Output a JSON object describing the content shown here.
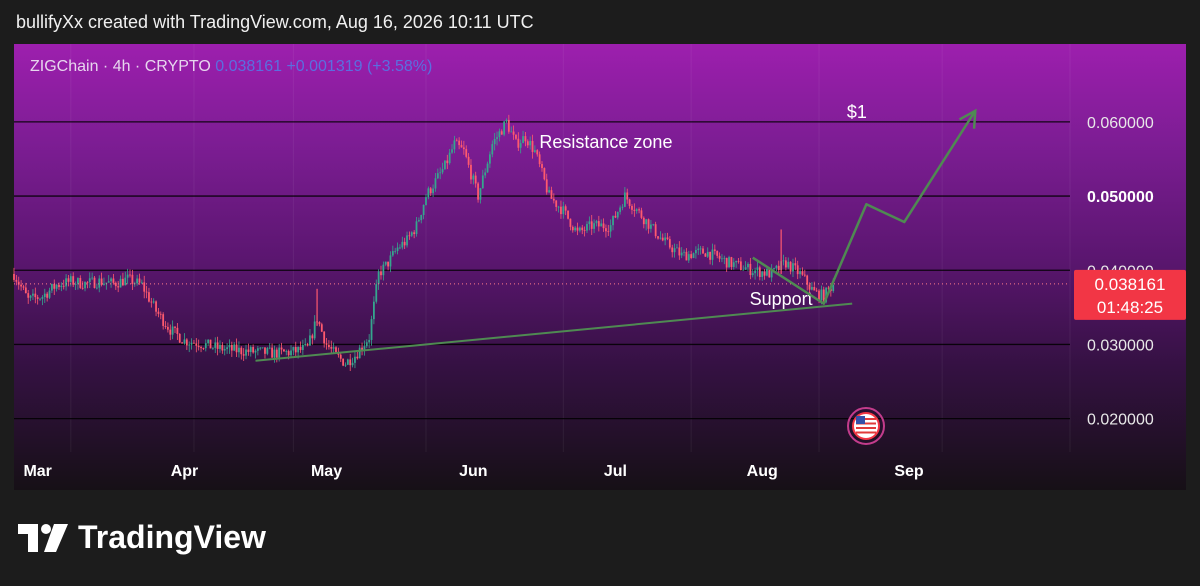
{
  "header": {
    "text": "bullifyXx created with TradingView.com, Aug 16, 2026 10:11 UTC"
  },
  "symbol": {
    "name": "ZIGChain",
    "interval": "4h",
    "type": "CRYPTO",
    "price": "0.038161",
    "change": "+0.001319 (+3.58%)"
  },
  "price_tag": {
    "price": "0.038161",
    "countdown": "01:48:25",
    "color": "#f23645"
  },
  "brand": {
    "name": "TradingView"
  },
  "colors": {
    "line": "#4f8a52",
    "up": "#35a68e",
    "down": "#ff5a6e",
    "gridline": "#000000"
  },
  "chart_data": {
    "type": "candlestick",
    "interval": "4h",
    "x_tick_labels": [
      "Mar",
      "Apr",
      "May",
      "Jun",
      "Jul",
      "Aug",
      "Sep"
    ],
    "y_tick_labels": [
      "0.060000",
      "0.050000",
      "0.040000",
      "0.030000",
      "0.020000"
    ],
    "y_ticks": [
      0.06,
      0.05,
      0.04,
      0.03,
      0.02
    ],
    "bold_y_tick": 0.05,
    "ylim": [
      0.0155,
      0.0705
    ],
    "xlim": [
      "2026-02-24",
      "2026-10-05"
    ],
    "current_price": 0.038161,
    "price_series": {
      "dates": [
        "2026-02-24",
        "2026-02-27",
        "2026-03-02",
        "2026-03-05",
        "2026-03-08",
        "2026-03-11",
        "2026-03-14",
        "2026-03-17",
        "2026-03-20",
        "2026-03-23",
        "2026-03-26",
        "2026-03-29",
        "2026-04-01",
        "2026-04-04",
        "2026-04-08",
        "2026-04-12",
        "2026-04-16",
        "2026-04-20",
        "2026-04-24",
        "2026-04-27",
        "2026-04-29",
        "2026-05-01",
        "2026-05-03",
        "2026-05-05",
        "2026-05-07",
        "2026-05-10",
        "2026-05-12",
        "2026-05-14",
        "2026-05-16",
        "2026-05-18",
        "2026-05-20",
        "2026-05-22",
        "2026-05-24",
        "2026-05-26",
        "2026-05-28",
        "2026-05-30",
        "2026-06-02",
        "2026-06-05",
        "2026-06-08",
        "2026-06-10",
        "2026-06-12",
        "2026-06-14",
        "2026-06-17",
        "2026-06-20",
        "2026-06-23",
        "2026-06-26",
        "2026-06-30",
        "2026-07-03",
        "2026-07-07",
        "2026-07-11",
        "2026-07-15",
        "2026-07-20",
        "2026-07-25",
        "2026-07-30",
        "2026-08-03",
        "2026-08-06",
        "2026-08-09",
        "2026-08-12",
        "2026-08-14",
        "2026-08-16"
      ],
      "close": [
        0.0395,
        0.036,
        0.0365,
        0.038,
        0.0385,
        0.0382,
        0.0385,
        0.0382,
        0.0388,
        0.038,
        0.0345,
        0.032,
        0.0305,
        0.0302,
        0.0295,
        0.0292,
        0.029,
        0.0288,
        0.029,
        0.0295,
        0.0335,
        0.03,
        0.0285,
        0.0275,
        0.0285,
        0.031,
        0.0395,
        0.041,
        0.043,
        0.044,
        0.046,
        0.05,
        0.052,
        0.054,
        0.057,
        0.056,
        0.05,
        0.057,
        0.06,
        0.057,
        0.058,
        0.056,
        0.05,
        0.048,
        0.045,
        0.046,
        0.046,
        0.05,
        0.047,
        0.044,
        0.042,
        0.0425,
        0.041,
        0.04,
        0.0395,
        0.041,
        0.0395,
        0.037,
        0.0365,
        0.038161
      ]
    },
    "volume_spikes": [
      {
        "date": "2026-04-29",
        "high": 0.0375
      },
      {
        "date": "2026-08-05",
        "high": 0.0455
      }
    ],
    "annotations": [
      {
        "type": "text",
        "text": "Resistance zone",
        "date": "2026-06-29",
        "value": 0.0565
      },
      {
        "type": "text",
        "text": "$1",
        "date": "2026-08-21",
        "value": 0.0605
      },
      {
        "type": "text",
        "text": "Support",
        "date": "2026-08-05",
        "value": 0.0353
      },
      {
        "type": "trendline",
        "label": "support line",
        "points": [
          [
            "2026-04-16",
            0.0278
          ],
          [
            "2026-08-20",
            0.0355
          ]
        ]
      },
      {
        "type": "path",
        "label": "projection",
        "points": [
          [
            "2026-07-30",
            0.0417
          ],
          [
            "2026-08-14",
            0.0355
          ],
          [
            "2026-08-23",
            0.0489
          ],
          [
            "2026-08-31",
            0.0465
          ],
          [
            "2026-09-15",
            0.0615
          ]
        ],
        "arrow": true
      }
    ]
  }
}
